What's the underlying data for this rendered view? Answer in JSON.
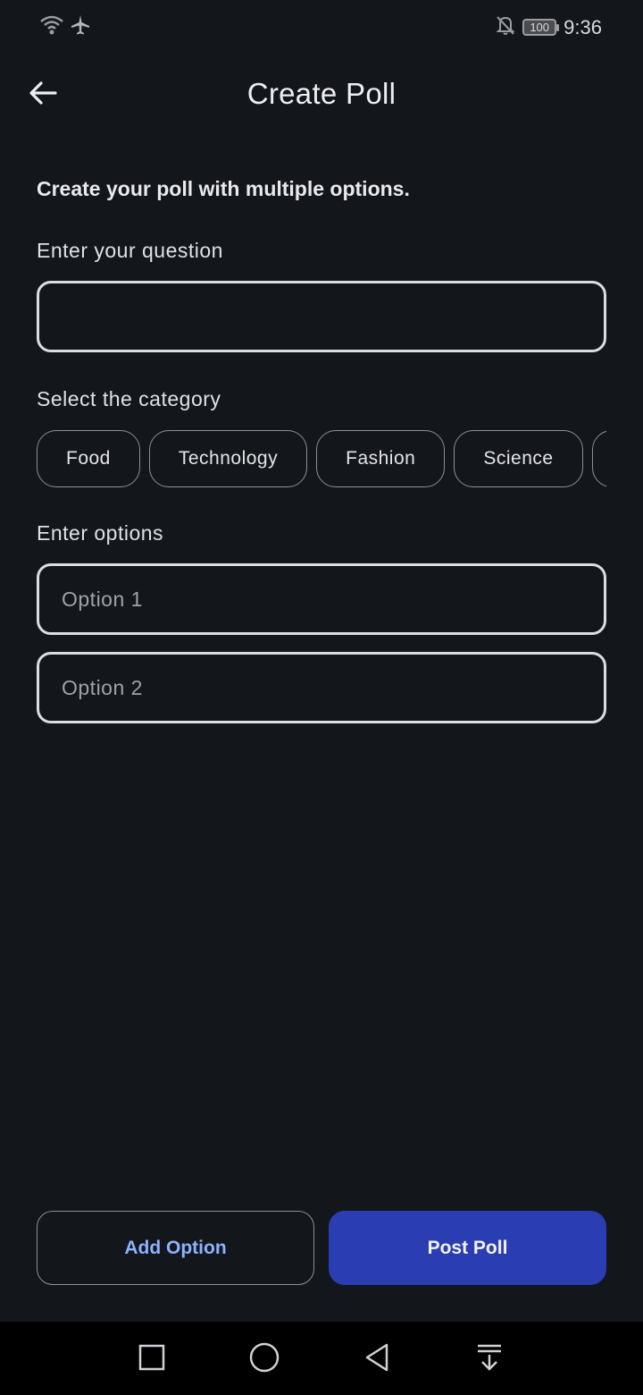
{
  "status_bar": {
    "time": "9:36",
    "battery": "100"
  },
  "header": {
    "title": "Create Poll"
  },
  "subtitle": "Create your poll with multiple options.",
  "question": {
    "label": "Enter your question",
    "value": "",
    "placeholder": ""
  },
  "category": {
    "label": "Select the category",
    "chips": [
      "Food",
      "Technology",
      "Fashion",
      "Science"
    ]
  },
  "options": {
    "label": "Enter options",
    "fields": [
      {
        "placeholder": "Option 1",
        "value": ""
      },
      {
        "placeholder": "Option 2",
        "value": ""
      }
    ]
  },
  "actions": {
    "add_option": "Add Option",
    "post_poll": "Post Poll"
  },
  "colors": {
    "background": "#13161b",
    "primary": "#2b3db3",
    "accent_text": "#8fb1ff"
  }
}
